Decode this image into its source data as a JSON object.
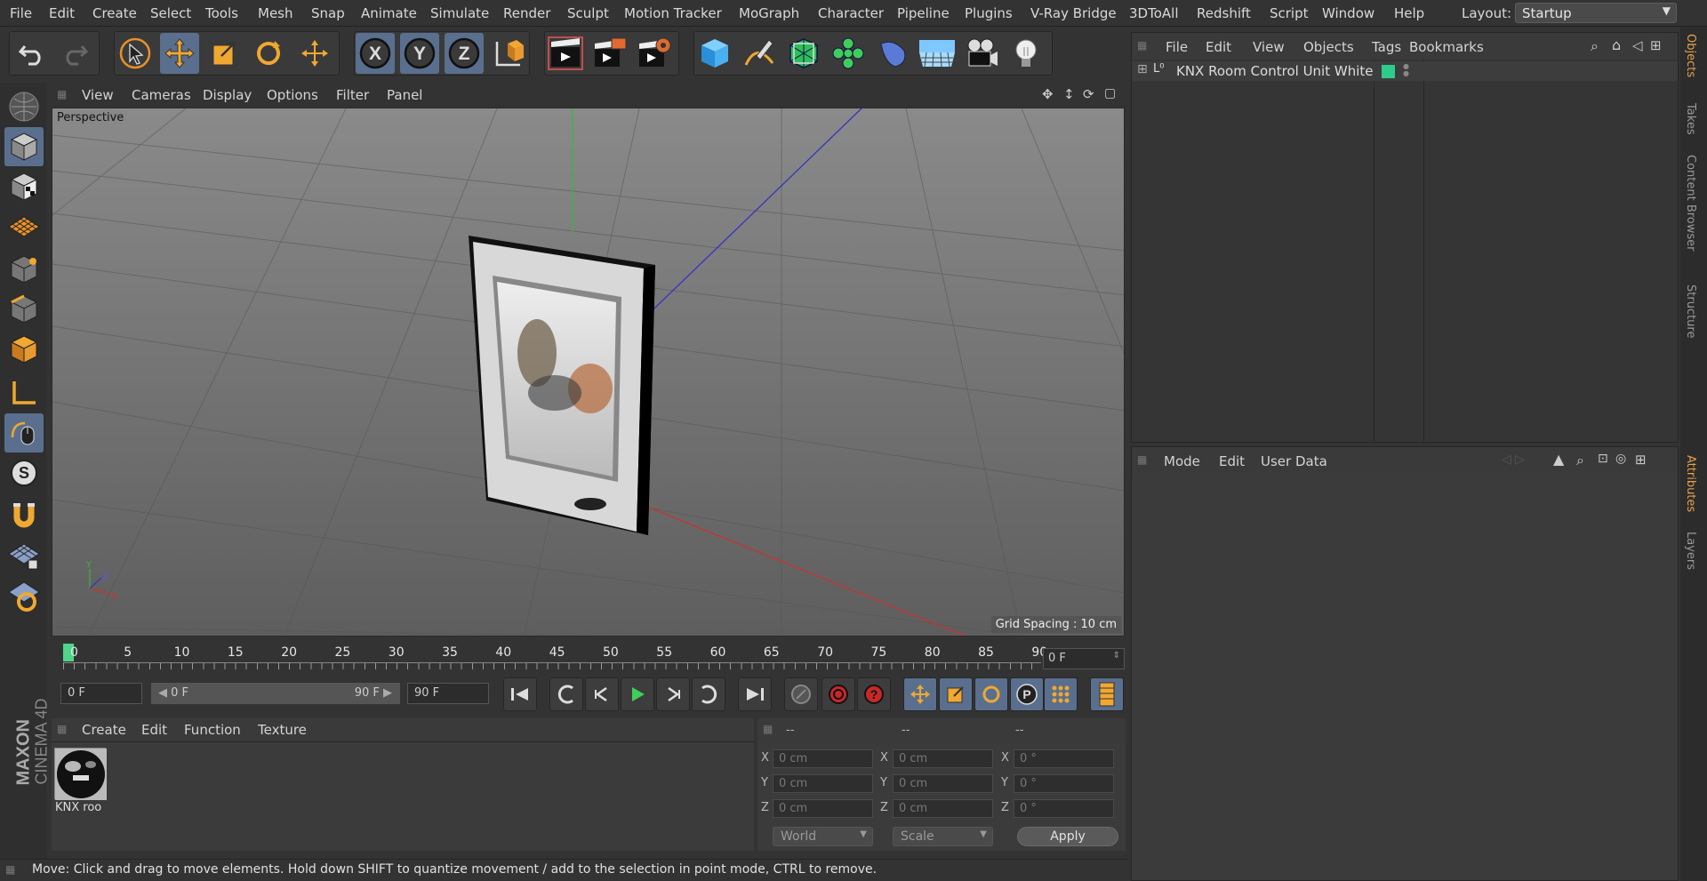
{
  "menubar": {
    "items": [
      "File",
      "Edit",
      "Create",
      "Select",
      "Tools",
      "Mesh",
      "Snap",
      "Animate",
      "Simulate",
      "Render",
      "Sculpt",
      "Motion Tracker",
      "MoGraph",
      "Character",
      "Pipeline",
      "Plugins",
      "V-Ray Bridge",
      "3DToAll",
      "Redshift",
      "Script",
      "Window",
      "Help"
    ],
    "layout_label": "Layout:",
    "layout_value": "Startup"
  },
  "toolbar": {
    "icons": [
      "undo-icon",
      "redo-icon",
      "select-cursor-icon",
      "move-icon",
      "scale-icon",
      "rotate-icon",
      "live-select-icon",
      "x-axis-icon",
      "y-axis-icon",
      "z-axis-icon",
      "coordinate-system-icon",
      "render-view-icon",
      "render-picture-viewer-icon",
      "render-settings-icon",
      "cube-primitive-icon",
      "pen-spline-icon",
      "subdivision-icon",
      "mograph-cloner-icon",
      "deformer-icon",
      "floor-environment-icon",
      "camera-icon",
      "light-icon"
    ],
    "axis_labels": [
      "X",
      "Y",
      "Z"
    ]
  },
  "viewport": {
    "menu": [
      "View",
      "Cameras",
      "Display",
      "Options",
      "Filter",
      "Panel"
    ],
    "camera_label": "Perspective",
    "grid_spacing": "Grid Spacing : 10 cm",
    "axis_labels": [
      "Y",
      "Z",
      "X"
    ]
  },
  "timeline": {
    "ticks": [
      "0",
      "5",
      "10",
      "15",
      "20",
      "25",
      "30",
      "35",
      "40",
      "45",
      "50",
      "55",
      "60",
      "65",
      "70",
      "75",
      "80",
      "85",
      "90"
    ],
    "current_frame": "0 F"
  },
  "transport": {
    "start_field": "0 F",
    "range_start": "0 F",
    "range_end": "90 F",
    "end_field": "90 F"
  },
  "material_manager": {
    "menu": [
      "Create",
      "Edit",
      "Function",
      "Texture"
    ],
    "materials": [
      {
        "name": "KNX roo"
      }
    ]
  },
  "coordinates": {
    "headers": [
      "--",
      "--",
      "--"
    ],
    "rows": [
      {
        "axis": "X",
        "pos": "0 cm",
        "size_axis": "X",
        "size": "0 cm",
        "rot_axis": "X",
        "rot": "0 °"
      },
      {
        "axis": "Y",
        "pos": "0 cm",
        "size_axis": "Y",
        "size": "0 cm",
        "rot_axis": "Y",
        "rot": "0 °"
      },
      {
        "axis": "Z",
        "pos": "0 cm",
        "size_axis": "Z",
        "size": "0 cm",
        "rot_axis": "Z",
        "rot": "0 °"
      }
    ],
    "space_select": "World",
    "mode_select": "Scale",
    "apply_label": "Apply"
  },
  "status": {
    "text": "Move: Click and drag to move elements. Hold down SHIFT to quantize movement / add to the selection in point mode, CTRL to remove."
  },
  "object_manager": {
    "menu": [
      "File",
      "Edit",
      "View",
      "Objects",
      "Tags",
      "Bookmarks"
    ],
    "objects": [
      {
        "name": "KNX Room Control Unit White",
        "layer_color": "#2ecc8a"
      }
    ]
  },
  "attribute_manager": {
    "menu": [
      "Mode",
      "Edit",
      "User Data"
    ]
  },
  "right_tabs": {
    "top": [
      "Objects",
      "Takes",
      "Content Browser",
      "Structure"
    ],
    "bottom": [
      "Attributes",
      "Layers"
    ]
  },
  "branding": {
    "logo_line1": "MAXON",
    "logo_line2": "CINEMA 4D"
  },
  "colors": {
    "accent": "#e5a14a",
    "selection": "#5a6f8e",
    "x_axis": "#c83232",
    "y_axis": "#3cb43c",
    "z_axis": "#3232c8",
    "active_frame": "#4fd68a"
  }
}
